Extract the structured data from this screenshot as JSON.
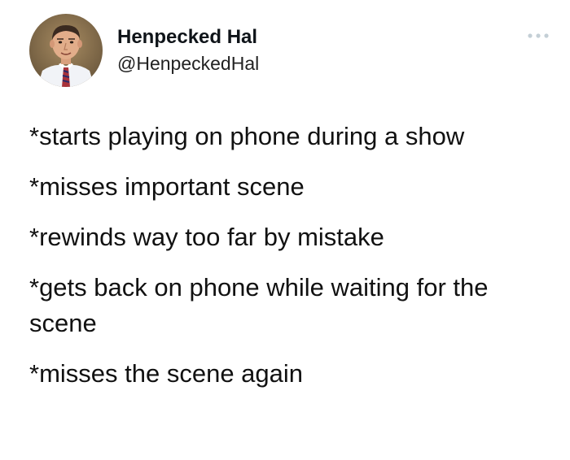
{
  "author": {
    "display_name": "Henpecked Hal",
    "handle": "@HenpeckedHal",
    "avatar_icon": "profile-photo-man-in-tie"
  },
  "menu": {
    "icon": "more-options-icon"
  },
  "tweet": {
    "lines": [
      "*starts playing on phone during a show",
      "*misses important scene",
      "*rewinds way too far by mistake",
      "*gets back on phone while waiting for the scene",
      "*misses the scene again"
    ]
  },
  "colors": {
    "text": "#0f1419",
    "muted": "#536471",
    "background": "#ffffff"
  }
}
